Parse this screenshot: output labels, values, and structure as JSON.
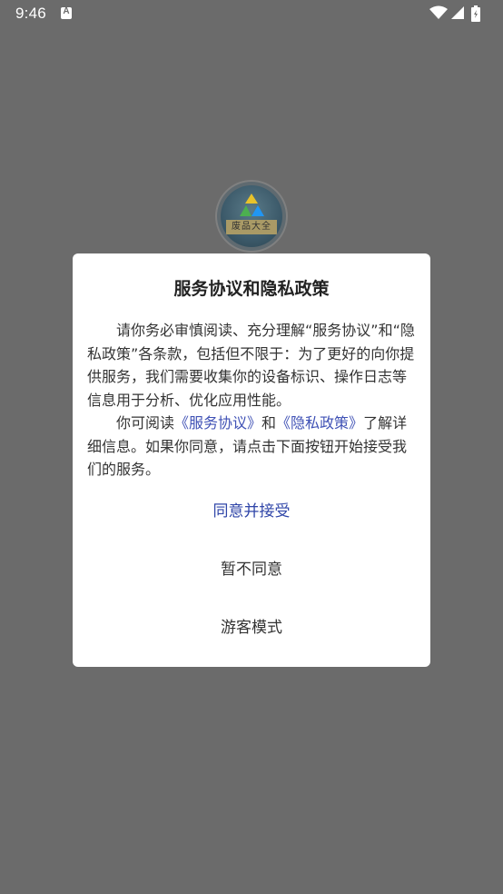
{
  "status_bar": {
    "time": "9:46",
    "notification_icon": "A",
    "icons": [
      "wifi-icon",
      "cell-signal-icon",
      "battery-icon"
    ],
    "text_color": "#ffffff"
  },
  "app": {
    "logo_text": "废品大全"
  },
  "dialog": {
    "title": "服务协议和隐私政策",
    "paragraph1": "请你务必审慎阅读、充分理解“服务协议”和“隐私政策”各条款，包括但不限于：为了更好的向你提供服务，我们需要收集你的设备标识、操作日志等信息用于分析、优化应用性能。",
    "paragraph2": {
      "prefix": "你可阅读",
      "link_service": "《服务协议》",
      "and": "和",
      "link_privacy": "《隐私政策》",
      "suffix": "了解详细信息。如果你同意，请点击下面按钮开始接受我们的服务。"
    },
    "buttons": {
      "agree": "同意并接受",
      "disagree": "暂不同意",
      "guest": "游客模式"
    }
  },
  "colors": {
    "overlay_background": "#6b6b6b",
    "link": "#3f51b5",
    "primary_button": "#2f45a8"
  }
}
